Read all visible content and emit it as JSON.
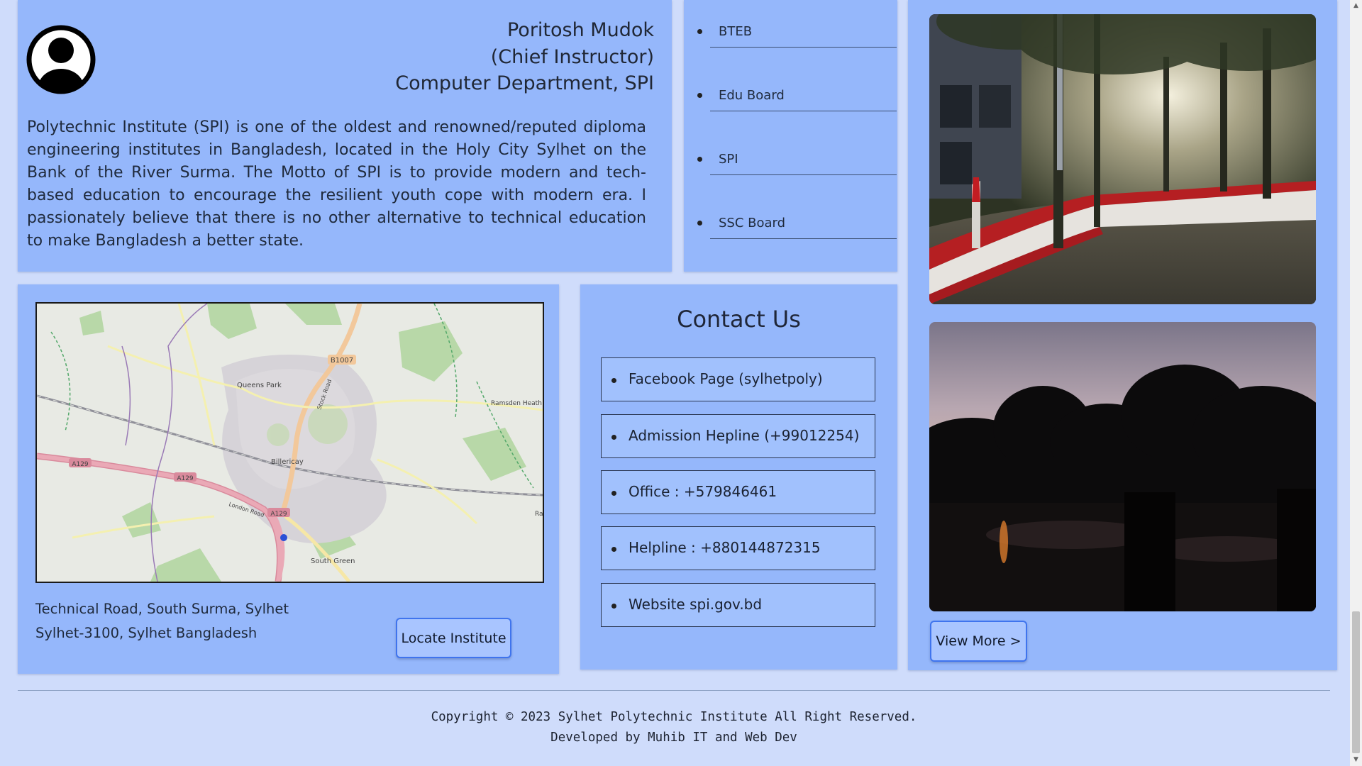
{
  "principal": {
    "name": "Poritosh Mudok",
    "role": "(Chief Instructor)",
    "department": "Computer Department, SPI",
    "message": "Polytechnic Institute (SPI) is one of the oldest and renowned/reputed diploma engineering institutes in Bangladesh, located in the Holy City Sylhet on the Bank of the River Surma. The Motto of SPI is to provide modern and tech-based education to encourage the resilient youth cope with modern era. I passionately believe that there is no other alternative to technical education to make Bangladesh a better state."
  },
  "links": {
    "items": [
      {
        "label": "BTEB"
      },
      {
        "label": "Edu Board"
      },
      {
        "label": "SPI"
      },
      {
        "label": "SSC Board"
      }
    ]
  },
  "map": {
    "labels": {
      "b1007": "B1007",
      "queens_park": "Queens Park",
      "ramsden_heath": "Ramsden Heath",
      "billericay": "Billericay",
      "a129_1": "A129",
      "a129_2": "A129",
      "a129_3": "A129",
      "london_road": "London Road",
      "stock_road": "Stock Road",
      "south_green": "South Green",
      "rail_label": "Ra"
    }
  },
  "address": {
    "line1": "Technical Road, South Surma, Sylhet",
    "line2": "Sylhet-3100, Sylhet Bangladesh",
    "locate_label": "Locate Institute"
  },
  "contact": {
    "title": "Contact Us",
    "items": [
      {
        "label": "Facebook Page (sylhetpoly)"
      },
      {
        "label": "Admission Hepline (+99012254)"
      },
      {
        "label": "Office : +579846461"
      },
      {
        "label": "Helpline : +880144872315"
      },
      {
        "label": "Website spi.gov.bd"
      }
    ]
  },
  "gallery": {
    "view_more_label": "View More >"
  },
  "footer": {
    "copyright": "Copyright © 2023 Sylhet Polytechnic Institute All Right Reserved.",
    "developed": "Developed by Muhib IT and Web Dev"
  },
  "colors": {
    "page_bg": "#cfdcfb",
    "card_bg": "#95b7fb",
    "button_border": "#3f74ee"
  }
}
